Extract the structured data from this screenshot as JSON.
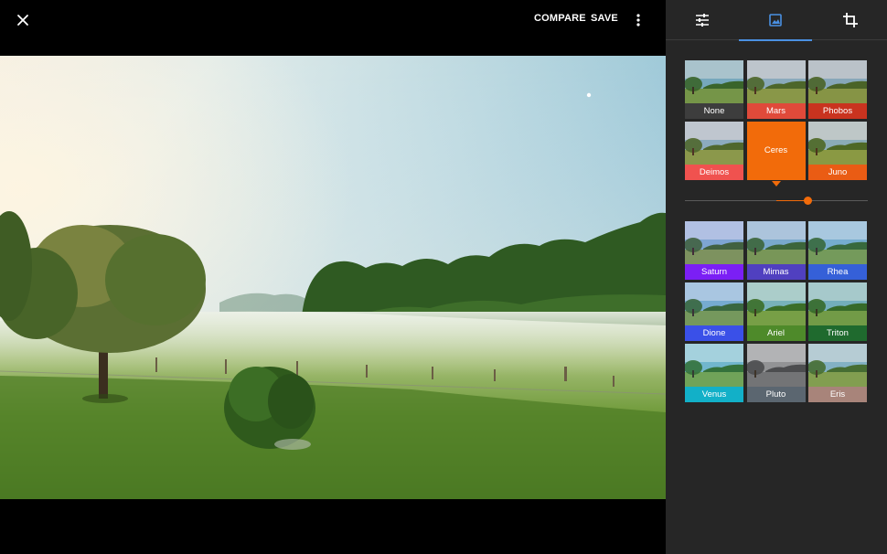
{
  "toolbar": {
    "compare_label": "COMPARE",
    "save_label": "SAVE",
    "close_icon": "close-icon",
    "more_icon": "more-vert-icon"
  },
  "panel": {
    "tabs": [
      {
        "name": "tune",
        "icon": "tune-icon"
      },
      {
        "name": "looks",
        "icon": "image-icon",
        "active": true
      },
      {
        "name": "crop",
        "icon": "crop-icon"
      }
    ],
    "accent": "#4a90e2"
  },
  "filters_top": [
    {
      "label": "None",
      "color": "#3d3d3d"
    },
    {
      "label": "Mars",
      "color": "#e04a3a"
    },
    {
      "label": "Phobos",
      "color": "#c9331f"
    },
    {
      "label": "Deimos",
      "color": "#f0524f"
    },
    {
      "label": "Ceres",
      "color": "#f26b0a",
      "selected": true
    },
    {
      "label": "Juno",
      "color": "#ea5c14"
    }
  ],
  "filters_bottom": [
    {
      "label": "Saturn",
      "color": "#7b1ff5"
    },
    {
      "label": "Mimas",
      "color": "#5040c0"
    },
    {
      "label": "Rhea",
      "color": "#3560d8"
    },
    {
      "label": "Dione",
      "color": "#3a50e8"
    },
    {
      "label": "Ariel",
      "color": "#4e8a2a"
    },
    {
      "label": "Triton",
      "color": "#1f6a2e"
    },
    {
      "label": "Venus",
      "color": "#12b0c8"
    },
    {
      "label": "Pluto",
      "color": "#5b6670"
    },
    {
      "label": "Eris",
      "color": "#a8847a"
    }
  ],
  "intensity": {
    "value": 0.67,
    "color": "#f26b0a"
  }
}
